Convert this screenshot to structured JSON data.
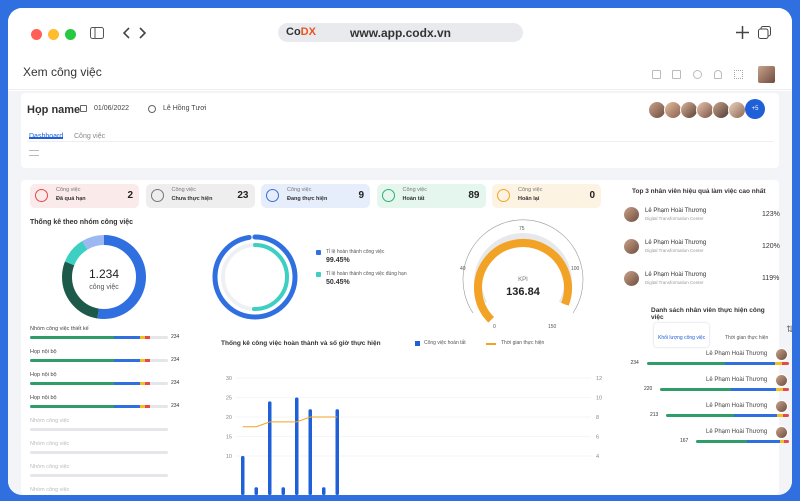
{
  "browser": {
    "url": "www.app.codx.vn",
    "logo_a": "Co",
    "logo_b": "DX"
  },
  "app": {
    "title": "Xem công việc"
  },
  "meeting": {
    "name": "Họp name",
    "date": "01/06/2022",
    "owner": "Lê Hồng Tươi",
    "extra_members": "+5"
  },
  "tabs": [
    {
      "label": "Dashboard"
    },
    {
      "label": "Công việc"
    }
  ],
  "stats": [
    {
      "l1": "Công việc",
      "l2": "Đã quá hạn",
      "value": "2",
      "color": "#e24b4b",
      "bg": "#fbeaea"
    },
    {
      "l1": "Công việc",
      "l2": "Chưa thực hiện",
      "value": "23",
      "color": "#777",
      "bg": "#eeeeee"
    },
    {
      "l1": "Công việc",
      "l2": "Đang thực hiện",
      "value": "9",
      "color": "#3b6fd8",
      "bg": "#e6edfb"
    },
    {
      "l1": "Công việc",
      "l2": "Hoàn tất",
      "value": "89",
      "color": "#2faf72",
      "bg": "#e5f6ee"
    },
    {
      "l1": "Công việc",
      "l2": "Hoãn lại",
      "value": "0",
      "color": "#f2a325",
      "bg": "#fdf3e2"
    }
  ],
  "group_chart": {
    "title": "Thống kê theo nhóm công việc",
    "center_value": "1.234",
    "center_label": "công việc"
  },
  "completion": {
    "rate_label": "Tỉ lệ hoàn thành công việc",
    "rate_value": "99.45%",
    "ontime_label": "Tỉ lệ hoàn thành công việc đúng hạn",
    "ontime_value": "50.45%",
    "rate_pct": 99.45,
    "ontime_pct": 50.45
  },
  "kpi": {
    "label": "KPI",
    "value": "136.84",
    "ticks": [
      "0",
      "40",
      "75",
      "100",
      "150"
    ],
    "min": 0,
    "max": 150
  },
  "group_list": [
    {
      "name": "Nhóm công việc thiết kế",
      "count": "234",
      "fill": 0.87
    },
    {
      "name": "Họp nội bộ",
      "count": "234",
      "fill": 0.87
    },
    {
      "name": "Họp nội bộ",
      "count": "234",
      "fill": 0.87
    },
    {
      "name": "Họp nội bộ",
      "count": "234",
      "fill": 0.87
    },
    {
      "name": "Nhóm công việc",
      "count": "",
      "fill": 0
    },
    {
      "name": "Nhóm công việc",
      "count": "",
      "fill": 0
    },
    {
      "name": "Nhóm công việc",
      "count": "",
      "fill": 0
    },
    {
      "name": "Nhóm công việc",
      "count": "",
      "fill": 0
    }
  ],
  "chart_data": {
    "type": "bar",
    "title": "Thống kê công việc hoàn thành và số giờ thực hiện",
    "series": [
      {
        "name": "Công việc hoàn tất",
        "type": "bar",
        "color": "#1f5fd8",
        "values": [
          10,
          2,
          24,
          2,
          25,
          22,
          2,
          22
        ]
      },
      {
        "name": "Thời gian thực hiện",
        "type": "line",
        "color": "#f2a325",
        "values": [
          7,
          7,
          7.5,
          7.5,
          7.5,
          8,
          8,
          8
        ]
      }
    ],
    "y_left_ticks": [
      "30",
      "25",
      "20",
      "15",
      "10"
    ],
    "y_right_ticks": [
      "12",
      "10",
      "8",
      "6",
      "4"
    ],
    "ylim": [
      0,
      30
    ],
    "ylim_right": [
      0,
      12
    ]
  },
  "top3": {
    "title": "Top 3 nhân viên hiệu quả làm việc cao nhất",
    "items": [
      {
        "name": "Lê Phạm Hoài Thương",
        "dept": "Digital Transformation Center",
        "value": "123%"
      },
      {
        "name": "Lê Phạm Hoài Thương",
        "dept": "Digital Transformation Center",
        "value": "120%"
      },
      {
        "name": "Lê Phạm Hoài Thương",
        "dept": "Digital Transformation Center",
        "value": "119%"
      }
    ]
  },
  "staff": {
    "title": "Danh sách nhân viên thực hiện công việc",
    "tab_a": "Khối lượng công việc",
    "tab_b": "Thời gian thực hiện",
    "items": [
      {
        "name": "Lê Phạm Hoài Thương",
        "count": "234",
        "fill": 0.95
      },
      {
        "name": "Lê Phạm Hoài Thương",
        "count": "220",
        "fill": 0.86
      },
      {
        "name": "Lê Phạm Hoài Thương",
        "count": "213",
        "fill": 0.82
      },
      {
        "name": "Lê Phạm Hoài Thương",
        "count": "167",
        "fill": 0.62
      }
    ]
  }
}
